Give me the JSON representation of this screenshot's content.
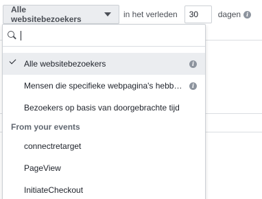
{
  "toolbar": {
    "audience_label": "Alle websitebezoekers",
    "in_past_label": "in het verleden",
    "days_value": "30",
    "days_label": "dagen"
  },
  "dropdown": {
    "search_placeholder": "",
    "items": [
      {
        "label": "Alle websitebezoekers",
        "selected": true,
        "info": true
      },
      {
        "label": "Mensen die specifieke webpagina's hebben bezocht",
        "selected": false,
        "info": true
      },
      {
        "label": "Bezoekers op basis van doorgebrachte tijd",
        "selected": false,
        "info": false
      }
    ],
    "section_header": "From your events",
    "events": [
      {
        "label": "connectretarget"
      },
      {
        "label": "PageView"
      },
      {
        "label": "InitiateCheckout"
      }
    ]
  }
}
